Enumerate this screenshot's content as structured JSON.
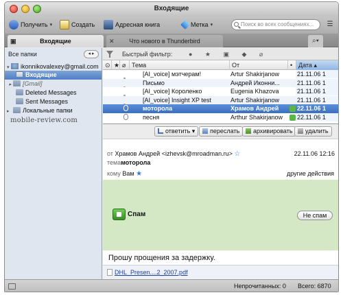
{
  "window": {
    "title": "Входящие"
  },
  "toolbar": {
    "get_label": "Получить",
    "create_label": "Создать",
    "address_book_label": "Адресная книга",
    "tag_label": "Метка",
    "search_placeholder": "Поиск во всех сообщениях...",
    "menu_icon": "menu-icon"
  },
  "tabs": [
    {
      "label": "Входящие",
      "active": true
    },
    {
      "label": "Что нового в Thunderbird",
      "active": false
    }
  ],
  "sidebar": {
    "header": "Все папки",
    "account": "ikonnikovalexey@gmail.com",
    "folders": [
      {
        "label": "Входящие",
        "selected": true
      },
      {
        "label": "[Gmail]"
      },
      {
        "label": "Deleted Messages"
      },
      {
        "label": "Sent Messages"
      },
      {
        "label": "Локальные папки"
      }
    ],
    "watermark": "mobile-review.com"
  },
  "filter": {
    "label": "Быстрый фильтр:"
  },
  "columns": {
    "subject": "Тема",
    "from": "От",
    "date": "Дата"
  },
  "messages": [
    {
      "subject": "[AI_voice] мэтчерам!",
      "from": "Artur Shakirjanow",
      "date": "21.11.06 1"
    },
    {
      "subject": "Письмо",
      "from": "Андрей Иконни...",
      "date": "21.11.06 1"
    },
    {
      "subject": "[AI_voice] Короленко",
      "from": "Eugenia Khazova",
      "date": "21.11.06 1"
    },
    {
      "subject": "[AI_voice] Insight XP test",
      "from": "Artur Shakirjanow",
      "date": "21.11.06 1"
    },
    {
      "subject": "моторола",
      "from": "Храмов Андрей",
      "date": "22.11.06 1",
      "selected": true
    },
    {
      "subject": "песня",
      "from": "Arthur Shakirjanow",
      "date": "22.11.06 1"
    }
  ],
  "actions": {
    "reply": "ответить",
    "forward": "переслать",
    "archive": "архивировать",
    "delete": "удалить"
  },
  "message": {
    "from_label": "от",
    "from_value": "Храмов Андрей <izhevsk@mroadman.ru>",
    "date": "22.11.06 12:16",
    "subject_label": "тема",
    "subject_value": "моторола",
    "to_label": "кому",
    "to_value": "Вам",
    "more_actions": "другие действия",
    "spam_label": "Спам",
    "not_spam": "Не спам",
    "body": "Прошу прощения за задержку.",
    "attachment": "DHL_Presen....2_2007.pdf"
  },
  "status": {
    "unread": "Непрочитанных: 0",
    "total": "Всего: 6870"
  }
}
